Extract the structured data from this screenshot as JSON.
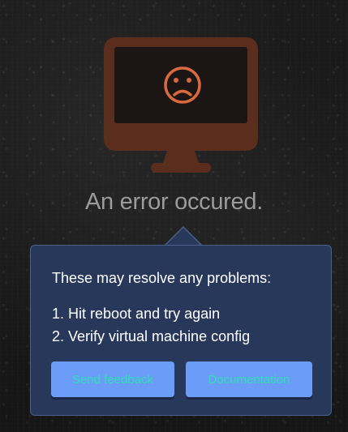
{
  "error": {
    "title": "An error occured."
  },
  "popover": {
    "heading": "These may resolve any problems:",
    "steps": [
      "1. Hit reboot and try again",
      "2. Verify virtual machine config"
    ],
    "buttons": {
      "feedback_label": "Send feedback",
      "docs_label": "Documentation"
    }
  },
  "colors": {
    "monitor": "#5a2d1d",
    "sad_face": "#d9693f",
    "popover_bg": "#28385a",
    "button_bg": "#6b9cf7",
    "button_text": "#2fe0b4"
  },
  "icons": {
    "monitor": "monitor-icon",
    "sad_face": "sad-face-icon"
  }
}
